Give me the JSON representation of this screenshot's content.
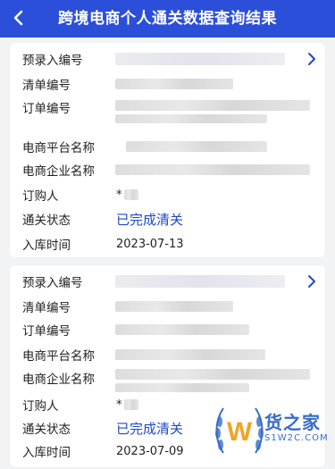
{
  "header": {
    "title": "跨境电商个人通关数据查询结果",
    "back_icon": "chevron-left-icon"
  },
  "colors": {
    "header_bg": "#2b4fd8",
    "status_text": "#1f49c7",
    "card_bg": "#ffffff",
    "page_bg": "#f2f3f5"
  },
  "records": [
    {
      "labels": {
        "pre_entry_no": "预录入编号",
        "list_no": "清单编号",
        "order_no": "订单编号",
        "platform_name": "电商平台名称",
        "enterprise_name": "电商企业名称",
        "buyer": "订购人",
        "clearance_status": "通关状态",
        "storage_time": "入库时间"
      },
      "buyer_prefix": "*",
      "clearance_status": "已完成清关",
      "storage_time": "2023-07-13"
    },
    {
      "labels": {
        "pre_entry_no": "预录入编号",
        "list_no": "清单编号",
        "order_no": "订单编号",
        "platform_name": "电商平台名称",
        "enterprise_name": "电商企业名称",
        "buyer": "订购人",
        "clearance_status": "通关状态",
        "storage_time": "入库时间"
      },
      "buyer_prefix": "*",
      "clearance_status": "已完成清关",
      "storage_time": "2023-07-09"
    }
  ],
  "watermark": {
    "brand": "货之家",
    "site": "S1W2C.COM"
  }
}
